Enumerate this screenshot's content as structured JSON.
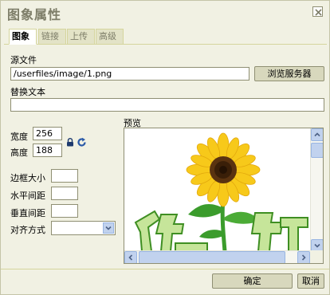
{
  "dialog": {
    "title": "图象属性",
    "close_label": "×"
  },
  "tabs": [
    {
      "label": "图象",
      "active": true
    },
    {
      "label": "链接",
      "active": false
    },
    {
      "label": "上传",
      "active": false
    },
    {
      "label": "高级",
      "active": false
    }
  ],
  "form": {
    "source_label": "源文件",
    "source_value": "/userfiles/image/1.png",
    "browse_label": "浏览服务器",
    "alt_label": "替换文本",
    "alt_value": "",
    "width_label": "宽度",
    "width_value": "256",
    "height_label": "高度",
    "height_value": "188",
    "border_label": "边框大小",
    "border_value": "",
    "hspace_label": "水平间距",
    "hspace_value": "",
    "vspace_label": "垂直间距",
    "vspace_value": "",
    "align_label": "对齐方式",
    "align_value": "",
    "preview_label": "预览"
  },
  "preview_image": {
    "text": "你好"
  },
  "footer": {
    "ok_label": "确定",
    "cancel_label": "取消"
  },
  "colors": {
    "background": "#f1f1e3",
    "title_text": "#7d7d68",
    "petal": "#f7c91a",
    "leaf": "#3b9c2c",
    "text_green": "#5fae3a"
  },
  "icons": {
    "lock": "lock-icon",
    "reset": "reset-size-icon",
    "close": "close-icon"
  }
}
